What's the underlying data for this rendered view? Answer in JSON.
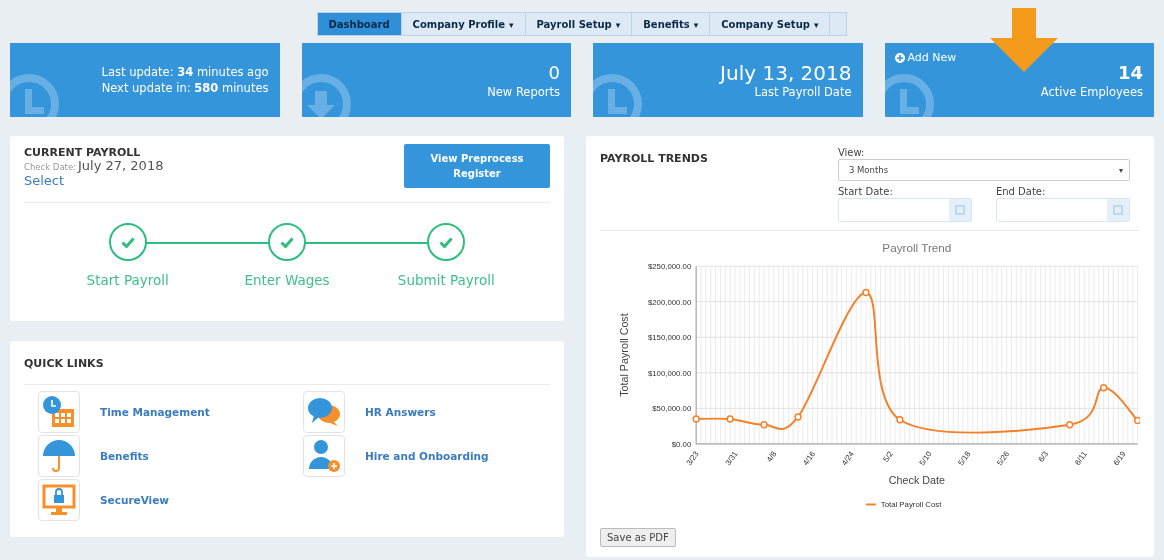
{
  "nav": {
    "tabs": [
      {
        "label": "Dashboard",
        "selected": true
      },
      {
        "label": "Company Profile",
        "selected": false,
        "caret": "▾"
      },
      {
        "label": "Payroll Setup",
        "selected": false,
        "caret": "▾"
      },
      {
        "label": "Benefits",
        "selected": false,
        "caret": "▾"
      },
      {
        "label": "Company Setup",
        "selected": false,
        "caret": "▾"
      }
    ]
  },
  "stats": [
    {
      "kind": "update",
      "lines": [
        "Last update: **34** minutes ago",
        "Next update in: **580** minutes"
      ]
    },
    {
      "kind": "reports",
      "value": "0",
      "label": "New Reports"
    },
    {
      "kind": "date",
      "value": "July 13, 2018",
      "label": "Last Payroll Date"
    },
    {
      "kind": "employees",
      "action": "Add New",
      "value": "14",
      "label": "Active Employees"
    }
  ],
  "current_payroll": {
    "title": "CURRENT PAYROLL",
    "check_label": "Check Date:",
    "check_date": "July 27, 2018",
    "select": "Select",
    "button": "View Preprocess Register",
    "steps": [
      {
        "label": "Start Payroll",
        "done": true
      },
      {
        "label": "Enter Wages",
        "done": true
      },
      {
        "label": "Submit Payroll",
        "done": true
      }
    ]
  },
  "quick_links": {
    "title": "QUICK LINKS",
    "items": [
      {
        "kind": "time",
        "label": "Time Management"
      },
      {
        "kind": "chat",
        "label": "HR Answers"
      },
      {
        "kind": "umbrella",
        "label": "Benefits"
      },
      {
        "kind": "person",
        "label": "Hire and Onboarding"
      },
      {
        "kind": "monitor",
        "label": "SecureView"
      }
    ]
  },
  "payroll_trends": {
    "title": "PAYROLL TRENDS",
    "view_label": "View:",
    "view_value": "3 Months",
    "view_caret": "▾",
    "start_label": "Start Date:",
    "end_label": "End Date:",
    "save_button": "Save as PDF",
    "chart_data": {
      "type": "line",
      "title": "Payroll Trend",
      "xlabel": "Check Date",
      "ylabel": "Total Payroll Cost",
      "categories": [
        "3/23",
        null,
        null,
        null,
        null,
        null,
        null,
        null,
        "3/31",
        null,
        null,
        null,
        null,
        null,
        null,
        null,
        "4/8",
        null,
        null,
        null,
        null,
        null,
        null,
        null,
        "4/16",
        null,
        null,
        null,
        null,
        null,
        null,
        null,
        "4/24",
        null,
        null,
        null,
        null,
        null,
        null,
        null,
        "5/2",
        null,
        null,
        null,
        null,
        null,
        null,
        null,
        "5/10",
        null,
        null,
        null,
        null,
        null,
        null,
        null,
        "5/18",
        null,
        null,
        null,
        null,
        null,
        null,
        null,
        "5/26",
        null,
        null,
        null,
        null,
        null,
        null,
        null,
        "6/3",
        null,
        null,
        null,
        null,
        null,
        null,
        null,
        "6/11",
        null,
        null,
        null,
        null,
        null,
        null,
        null,
        "6/19",
        null,
        null,
        null
      ],
      "series": [
        {
          "name": "Total Payroll Cost",
          "color": "#f5802a",
          "marker": "circle",
          "values": [
            35000,
            null,
            null,
            null,
            null,
            null,
            null,
            35000,
            null,
            null,
            null,
            null,
            null,
            null,
            27000,
            null,
            null,
            null,
            null,
            null,
            null,
            38000,
            null,
            null,
            null,
            null,
            null,
            null,
            null,
            null,
            null,
            null,
            null,
            null,
            null,
            213000,
            null,
            null,
            null,
            null,
            null,
            null,
            34000,
            null,
            null,
            null,
            null,
            null,
            null,
            null,
            null,
            null,
            null,
            null,
            null,
            null,
            null,
            null,
            null,
            null,
            null,
            null,
            null,
            null,
            null,
            null,
            null,
            null,
            null,
            null,
            null,
            null,
            null,
            null,
            null,
            null,
            null,
            27000,
            null,
            null,
            null,
            null,
            null,
            null,
            79000,
            null,
            null,
            null,
            null,
            null,
            null,
            33000
          ]
        }
      ],
      "ylim": [
        0,
        250000
      ],
      "grid": true,
      "yticks": [
        {
          "value": 0,
          "label": "$0.00"
        },
        {
          "value": 50000,
          "label": "$50,000.00"
        },
        {
          "value": 100000,
          "label": "$100,000.00"
        },
        {
          "value": 150000,
          "label": "$150,000.00"
        },
        {
          "value": 200000,
          "label": "$200,000.00"
        },
        {
          "value": 250000,
          "label": "$250,000.00"
        }
      ]
    }
  },
  "annotation": {
    "arrow": true
  }
}
